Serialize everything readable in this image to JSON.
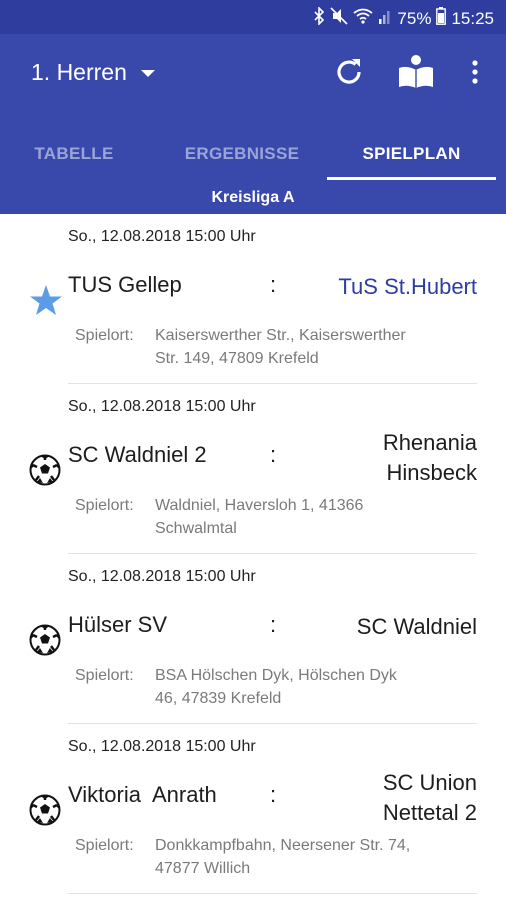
{
  "status_bar": {
    "battery": "75%",
    "time": "15:25"
  },
  "app_bar": {
    "team": "1. Herren",
    "actions": [
      "refresh-icon",
      "rulebook-icon",
      "more-vert-icon"
    ]
  },
  "tabs": [
    {
      "label": "TABELLE",
      "active": false
    },
    {
      "label": "ERGEBNISSE",
      "active": false
    },
    {
      "label": "SPIELPLAN",
      "active": true
    }
  ],
  "league": "Kreisliga A",
  "matches": [
    {
      "date": "So., 12.08.2018",
      "time": "15:00 Uhr",
      "icon": "star-icon",
      "home": "TUS Gellep",
      "sep": ":",
      "away_lines": [
        "TuS St.Hubert"
      ],
      "venue_label": "Spielort:",
      "venue_lines": [
        "Kaiserswerther Str., Kaiserswerther",
        "Str. 149, 47809 Krefeld"
      ]
    },
    {
      "date": "So., 12.08.2018",
      "time": "15:00 Uhr",
      "icon": "soccer-ball-icon",
      "home": "SC Waldniel 2",
      "sep": ":",
      "away_lines": [
        "Rhenania",
        "Hinsbeck"
      ],
      "venue_label": "Spielort:",
      "venue_lines": [
        "Waldniel, Haversloh 1, 41366",
        "Schwalmtal"
      ]
    },
    {
      "date": "So., 12.08.2018",
      "time": "15:00 Uhr",
      "icon": "soccer-ball-icon",
      "home": "Hülser SV",
      "sep": ":",
      "away_lines": [
        "SC Waldniel"
      ],
      "venue_label": "Spielort:",
      "venue_lines": [
        "BSA Hölschen Dyk, Hölschen Dyk",
        "46, 47839 Krefeld"
      ]
    },
    {
      "date": "So., 12.08.2018",
      "time": "15:00 Uhr",
      "icon": "soccer-ball-icon",
      "home": "Viktoria  Anrath",
      "sep": ":",
      "away_lines": [
        "SC Union",
        "Nettetal 2"
      ],
      "venue_label": "Spielort:",
      "venue_lines": [
        "Donkkampfbahn, Neersener Str. 74,",
        "47877 Willich"
      ]
    }
  ],
  "colors": {
    "status_bar": "#2f3e9e",
    "app_bar": "#3949ab",
    "highlight_team": "#2f3e9e",
    "favorite_star": "#5c9be6"
  }
}
